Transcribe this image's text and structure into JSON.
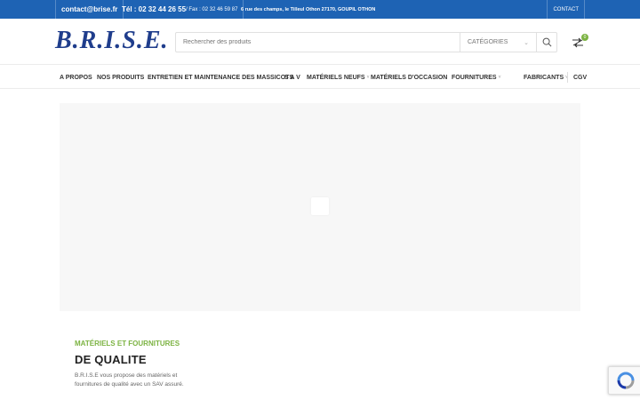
{
  "topbar": {
    "email": "contact@brise.fr",
    "phone_label": "Tél : 02 32 44 26 55",
    "fax_label": " / Fax : 02 32 46 59 87",
    "address": "6 rue des champs,  le Tilleul Othon 27170,  GOUPIL OTHON",
    "contact_link": "CONTACT"
  },
  "header": {
    "logo_text": "B.R.I.S.E.",
    "search_placeholder": "Rechercher des produits",
    "categories_label": "CATÉGORIES",
    "compare_count": "0"
  },
  "nav": {
    "items": [
      {
        "label": "A PROPOS"
      },
      {
        "label": "NOS PRODUITS"
      },
      {
        "label": "ENTRETIEN ET MAINTENANCE DES MASSICOTS"
      },
      {
        "label": "S A V"
      },
      {
        "label": "MATÉRIELS NEUFS"
      },
      {
        "label": "MATÉRIELS D'OCCASION"
      },
      {
        "label": "FOURNITURES"
      },
      {
        "label": "FABRICANTS"
      },
      {
        "label": "CGV"
      }
    ]
  },
  "content": {
    "subtitle": "MATÉRIELS ET FOURNITURES",
    "headline": "DE QUALITE",
    "description": "B.R.I.S.E vous propose des matériels et fournitures de qualité avec un SAV assuré."
  },
  "colors": {
    "topbar": "#1e63b4",
    "logo": "#1f3d8c",
    "accent_green": "#7cb342"
  },
  "icons": {
    "search": "search-icon",
    "compare": "compare-arrows-icon",
    "chevron": "chevron-down-icon",
    "recaptcha": "recaptcha-icon"
  }
}
